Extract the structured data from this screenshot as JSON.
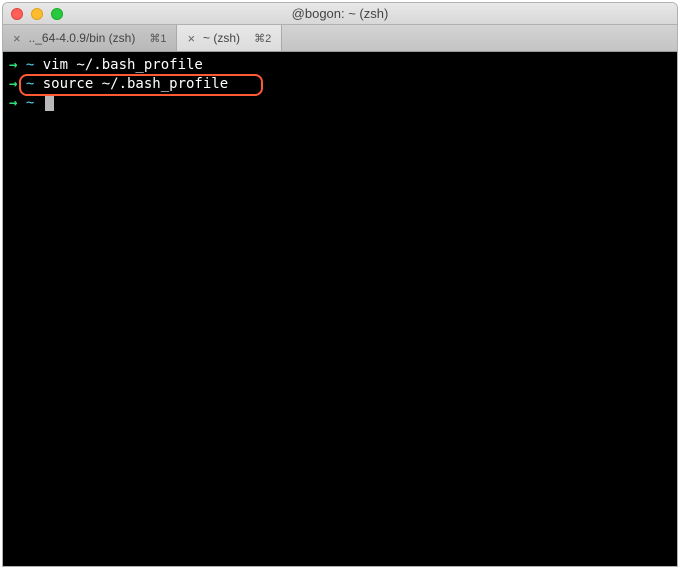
{
  "window": {
    "title": "@bogon: ~ (zsh)"
  },
  "tabs": [
    {
      "label": ".._64-4.0.9/bin (zsh)",
      "shortcut": "⌘1",
      "active": false
    },
    {
      "label": "~ (zsh)",
      "shortcut": "⌘2",
      "active": true
    }
  ],
  "terminal": {
    "lines": [
      {
        "arrow": "→ ",
        "path": "~ ",
        "cmd": "vim ~/.bash_profile"
      },
      {
        "arrow": "→ ",
        "path": "~ ",
        "cmd": "source ~/.bash_profile"
      },
      {
        "arrow": "→ ",
        "path": "~ ",
        "cmd": ""
      }
    ]
  }
}
